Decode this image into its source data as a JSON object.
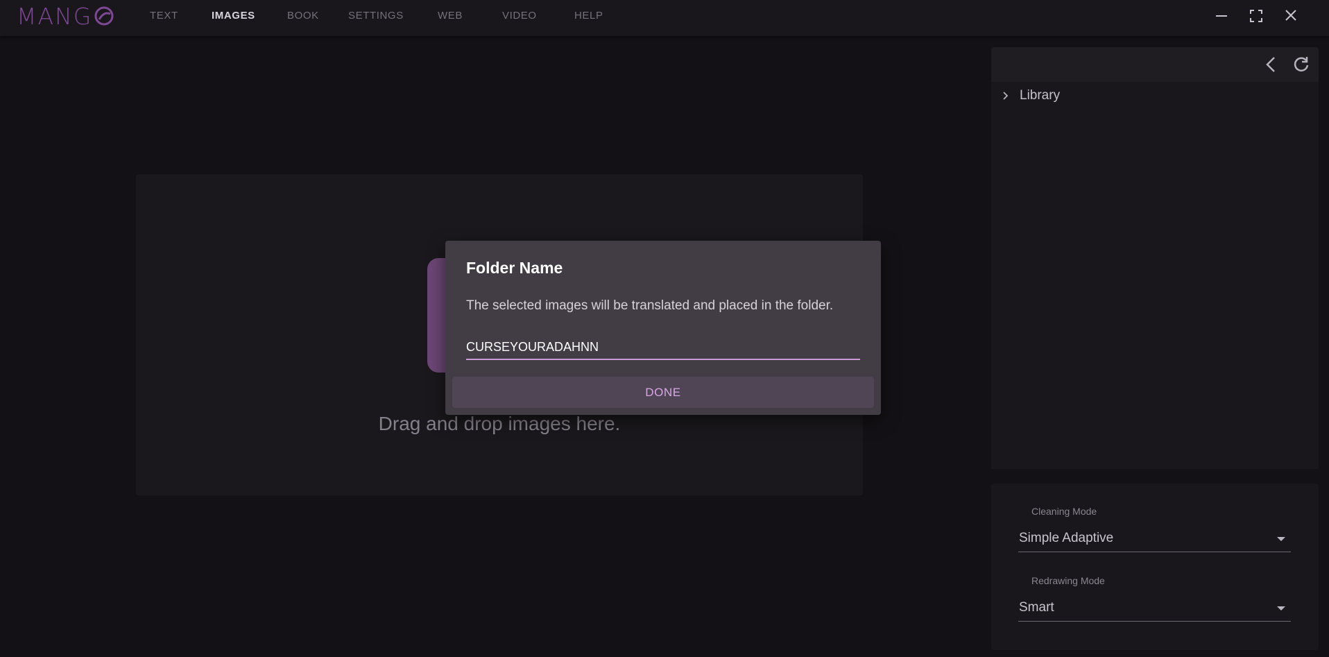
{
  "app": {
    "logo_text": "MANG",
    "logo_icon": "mango-o-logo"
  },
  "nav": {
    "items": [
      {
        "label": "TEXT"
      },
      {
        "label": "IMAGES"
      },
      {
        "label": "BOOK"
      },
      {
        "label": "SETTINGS"
      },
      {
        "label": "WEB"
      },
      {
        "label": "VIDEO"
      },
      {
        "label": "HELP"
      }
    ],
    "active": "IMAGES"
  },
  "window_controls": [
    "minimize-icon",
    "fullscreen-icon",
    "close-icon"
  ],
  "main": {
    "dropzone_text": "Drag and drop images here."
  },
  "sidebar": {
    "header_icons": [
      "back-icon",
      "refresh-icon"
    ],
    "tree": [
      {
        "label": "Library",
        "expanded": false
      }
    ]
  },
  "settings": {
    "cleaning_mode": {
      "label": "Cleaning Mode",
      "value": "Simple Adaptive"
    },
    "redrawing_mode": {
      "label": "Redrawing Mode",
      "value": "Smart"
    }
  },
  "dialog": {
    "title": "Folder Name",
    "message": "The selected images will be translated and placed in the folder.",
    "input_value": "CURSEYOURADAHNN",
    "button_label": "DONE"
  },
  "colors": {
    "background": "#131115",
    "accent": "#7d4894",
    "dialog_bg": "#423c44",
    "button_text": "#d8a6e6",
    "input_underline": "#c99ad6"
  }
}
